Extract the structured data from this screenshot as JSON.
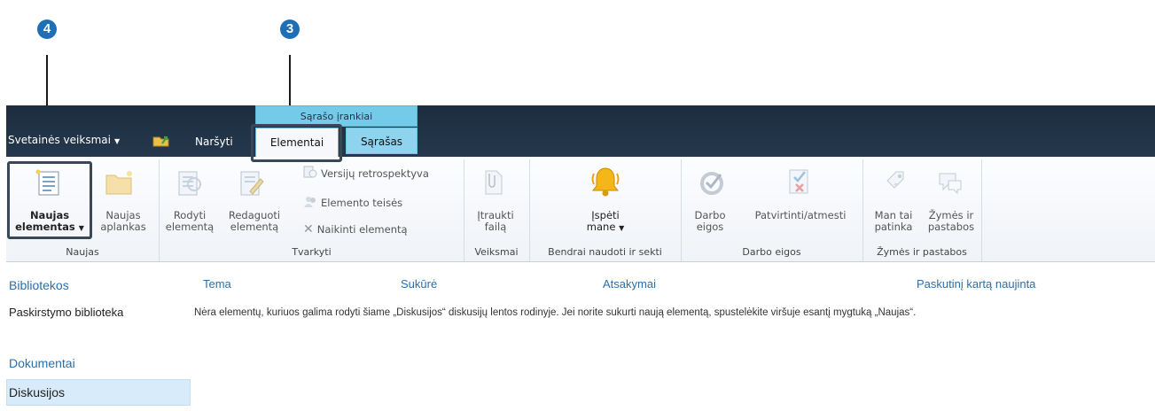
{
  "callouts": {
    "first": "4",
    "second": "3"
  },
  "topbar": {
    "site_actions": "Svetainės veiksmai",
    "browse_tab": "Naršyti",
    "context_group": "Sąrašo įrankiai",
    "items_tab": "Elementai",
    "list_tab": "Sąrašas"
  },
  "ribbon": {
    "groups": {
      "new": "Naujas",
      "manage": "Tvarkyti",
      "actions": "Veiksmai",
      "share": "Bendrai naudoti ir sekti",
      "workflows": "Darbo eigos",
      "tags": "Žymės ir pastabos"
    },
    "new_item": [
      "Naujas",
      "elementas"
    ],
    "new_folder": [
      "Naujas",
      "aplankas"
    ],
    "view_item": [
      "Rodyti",
      "elementą"
    ],
    "edit_item": [
      "Redaguoti",
      "elementą"
    ],
    "version_history": "Versijų retrospektyva",
    "item_permissions": "Elemento teisės",
    "delete_item": "Naikinti elementą",
    "attach_file": [
      "Įtraukti",
      "failą"
    ],
    "alert_me": [
      "Įspėti",
      "mane"
    ],
    "workflows_btn": [
      "Darbo",
      "eigos"
    ],
    "approve_reject": "Patvirtinti/atmesti",
    "like_it": [
      "Man tai",
      "patinka"
    ],
    "tags_notes": [
      "Žymės ir",
      "pastabos"
    ]
  },
  "leftnav": {
    "libraries_head": "Bibliotekos",
    "distribution_lib": "Paskirstymo biblioteka",
    "documents": "Dokumentai",
    "discussions": "Diskusijos"
  },
  "list": {
    "columns": [
      "Tema",
      "Sukūrė",
      "Atsakymai",
      "Paskutinį kartą naujinta"
    ],
    "empty_message": "Nėra elementų, kuriuos galima rodyti šiame „Diskusijos“ diskusijų lentos rodinyje. Jei norite sukurti naują elementą, spustelėkite viršuje esantį mygtuką „Naujas“."
  },
  "colors": {
    "accent": "#1f6fb6",
    "topbar": "#223346",
    "context_tab": "#74cbe9",
    "link": "#2d6fa6"
  }
}
